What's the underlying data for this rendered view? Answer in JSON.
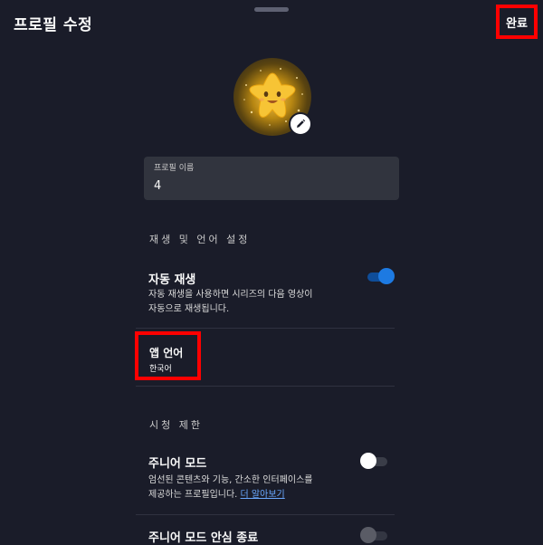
{
  "header": {
    "title": "프로필 수정",
    "done_label": "완료"
  },
  "avatar": {
    "icon": "star-character-avatar",
    "edit_icon": "pencil-icon"
  },
  "profile_name": {
    "label": "프로필 이름",
    "value": "4"
  },
  "playback_language_section": {
    "header": "재생 및 언어 설정",
    "autoplay": {
      "title": "자동 재생",
      "description_line1": "자동 재생을 사용하면 시리즈의 다음 영상이",
      "description_line2": "자동으로 재생됩니다.",
      "enabled": true
    },
    "app_language": {
      "title": "앱 언어",
      "value": "한국어"
    }
  },
  "viewing_restrictions_section": {
    "header": "시청 제한",
    "junior_mode": {
      "title": "주니어 모드",
      "description_line1": "엄선된 콘텐츠와 기능, 간소한 인터페이스를",
      "description_line2": "제공하는 프로필입니다.",
      "learn_more": "더 알아보기",
      "enabled": false
    },
    "junior_mode_safe_exit": {
      "title": "주니어 모드 안심 종료",
      "enabled": false
    }
  },
  "colors": {
    "background": "#1a1c29",
    "field_background": "#31343e",
    "toggle_on": "#1d7ae2",
    "link": "#6aa9ff",
    "highlight_box": "#ff0000"
  }
}
